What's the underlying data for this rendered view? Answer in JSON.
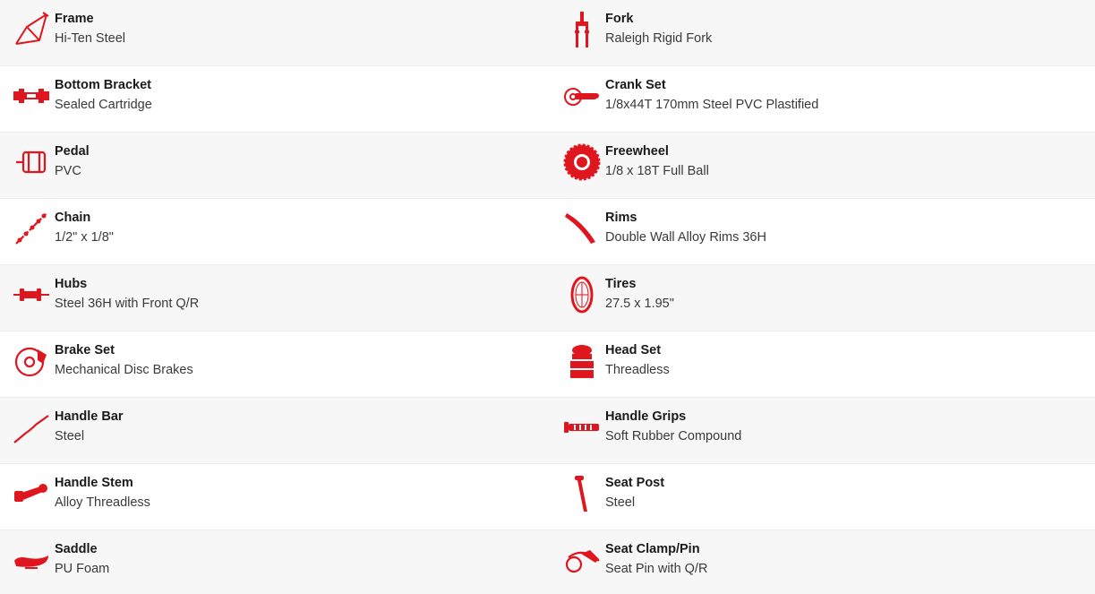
{
  "accent_color": "#e0161e",
  "specs": [
    {
      "left": {
        "label": "Frame",
        "value": "Hi-Ten Steel",
        "icon": "frame-icon"
      },
      "right": {
        "label": "Fork",
        "value": "Raleigh Rigid Fork",
        "icon": "fork-icon"
      }
    },
    {
      "left": {
        "label": "Bottom Bracket",
        "value": "Sealed Cartridge",
        "icon": "bottom-bracket-icon"
      },
      "right": {
        "label": "Crank Set",
        "value": "1/8x44T 170mm Steel PVC Plastified",
        "icon": "crank-set-icon"
      }
    },
    {
      "left": {
        "label": "Pedal",
        "value": "PVC",
        "icon": "pedal-icon"
      },
      "right": {
        "label": "Freewheel",
        "value": "1/8 x 18T Full Ball",
        "icon": "freewheel-icon"
      }
    },
    {
      "left": {
        "label": "Chain",
        "value": "1/2\" x 1/8\"",
        "icon": "chain-icon"
      },
      "right": {
        "label": "Rims",
        "value": "Double Wall Alloy Rims 36H",
        "icon": "rims-icon"
      }
    },
    {
      "left": {
        "label": "Hubs",
        "value": "Steel 36H with Front Q/R",
        "icon": "hubs-icon"
      },
      "right": {
        "label": "Tires",
        "value": "27.5 x 1.95\"",
        "icon": "tires-icon"
      }
    },
    {
      "left": {
        "label": "Brake Set",
        "value": "Mechanical Disc Brakes",
        "icon": "brake-set-icon"
      },
      "right": {
        "label": "Head Set",
        "value": "Threadless",
        "icon": "head-set-icon"
      }
    },
    {
      "left": {
        "label": "Handle Bar",
        "value": "Steel",
        "icon": "handle-bar-icon"
      },
      "right": {
        "label": "Handle Grips",
        "value": "Soft Rubber Compound",
        "icon": "handle-grips-icon"
      }
    },
    {
      "left": {
        "label": "Handle Stem",
        "value": "Alloy Threadless",
        "icon": "handle-stem-icon"
      },
      "right": {
        "label": "Seat Post",
        "value": "Steel",
        "icon": "seat-post-icon"
      }
    },
    {
      "left": {
        "label": "Saddle",
        "value": "PU Foam",
        "icon": "saddle-icon"
      },
      "right": {
        "label": "Seat Clamp/Pin",
        "value": "Seat Pin with Q/R",
        "icon": "seat-clamp-icon"
      }
    }
  ]
}
